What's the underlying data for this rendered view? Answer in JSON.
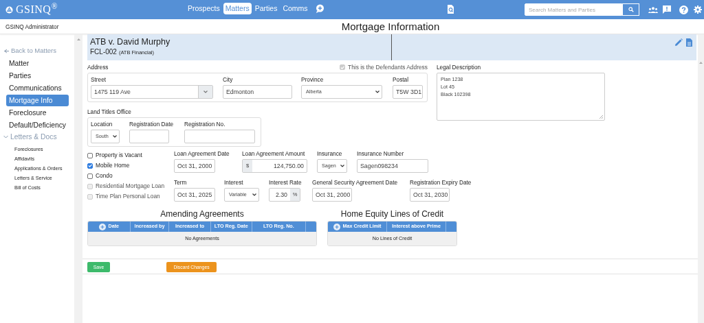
{
  "nav": {
    "logo": "GSINQ$^{®}$",
    "items": [
      {
        "label": "Prospects",
        "selected": false
      },
      {
        "label": "Matters",
        "selected": true
      },
      {
        "label": "Parties",
        "selected": false
      },
      {
        "label": "Comms",
        "selected": false
      }
    ],
    "search": {
      "placeholder": "Search Matters and Parties"
    }
  },
  "user": "GSINQ Administrator",
  "page_title": "Mortgage Information",
  "sidebar": {
    "back": "Back to Matters",
    "items": [
      {
        "label": "Matter",
        "selected": false
      },
      {
        "label": "Parties",
        "selected": false
      },
      {
        "label": "Communications",
        "selected": false
      },
      {
        "label": "Mortgage Info",
        "selected": true
      },
      {
        "label": "Foreclosure",
        "selected": false
      },
      {
        "label": "Default/Deficiency",
        "selected": false
      }
    ],
    "section": {
      "label": "Letters & Docs",
      "expanded": true,
      "children": [
        "Foreclosures",
        "Affidavits",
        "Applications & Orders",
        "Letters & Service",
        "Bill of Costs"
      ]
    }
  },
  "matter": {
    "title": "ATB v. David Murphy",
    "number": "FCL-002",
    "client": "(ATB Financial)"
  },
  "address": {
    "label": "Address",
    "defendant": {
      "label": "This is the Defendants Address",
      "checked": true,
      "disabled": true
    },
    "fields": [
      {
        "label": "Street",
        "value": "1475 119 Ave",
        "kind": "combo"
      },
      {
        "label": "City",
        "value": "Edmonton",
        "kind": "text"
      },
      {
        "label": "Province",
        "value": "Alberta",
        "kind": "select"
      },
      {
        "label": "Postal",
        "value": "T5W 3D1",
        "kind": "text"
      }
    ]
  },
  "legal": {
    "label": "Legal Description",
    "value": "Plan 1238\nLot 45\nBlack 102398"
  },
  "land_titles": {
    "label": "Land Titles Office",
    "fields": [
      {
        "label": "Location",
        "value": "South",
        "kind": "select"
      },
      {
        "label": "Registration Date",
        "kind": "text"
      },
      {
        "label": "Registration No.",
        "kind": "text"
      }
    ]
  },
  "flags": [
    {
      "label": "Property is Vacant",
      "checked": false,
      "disabled": false
    },
    {
      "label": "Mobile Home",
      "checked": true,
      "disabled": false
    },
    {
      "label": "Condo",
      "checked": false,
      "disabled": false
    },
    {
      "label": "Residential Mortgage Loan",
      "checked": false,
      "disabled": true
    },
    {
      "label": "Time Plan Personal Loan",
      "checked": false,
      "disabled": true
    }
  ],
  "loan_rows": [
    [
      {
        "label": "Loan Agreement Date",
        "value": "Oct 31, 2000",
        "kind": "text"
      },
      {
        "label": "Loan Agreement Amount",
        "value": "124,750.00",
        "kind": "money",
        "prefix": "$"
      },
      {
        "label": "Insurance",
        "value": "Sagen",
        "kind": "select"
      },
      {
        "label": "Insurance Number",
        "value": "Sagen098234",
        "kind": "text"
      }
    ],
    [
      {
        "label": "Term",
        "value": "Oct 31, 2025",
        "kind": "text"
      },
      {
        "label": "Interest",
        "value": "Variable",
        "kind": "select"
      },
      {
        "label": "Interest Rate",
        "value": "2.30",
        "kind": "percent",
        "suffix": "%"
      },
      {
        "label": "General Security Agreement Date",
        "value": "Oct 31, 2000",
        "kind": "text"
      },
      {
        "label": "Registration Expiry Date",
        "value": "Oct 31, 2030",
        "kind": "text"
      }
    ]
  ],
  "tables": [
    {
      "title": "Amending Agreements",
      "columns": [
        "Date",
        "Increased by",
        "Increased to",
        "LTO Reg. Date",
        "LTO Reg. No."
      ],
      "empty": "No Agreements"
    },
    {
      "title": "Home Equity Lines of Credit",
      "columns": [
        "Max Credit Limit",
        "Interest above Prime"
      ],
      "empty": "No Lines of Credit"
    }
  ],
  "buttons": [
    {
      "label": "Save",
      "kind": "save"
    },
    {
      "label": "Discard Changes",
      "kind": "discard"
    }
  ]
}
